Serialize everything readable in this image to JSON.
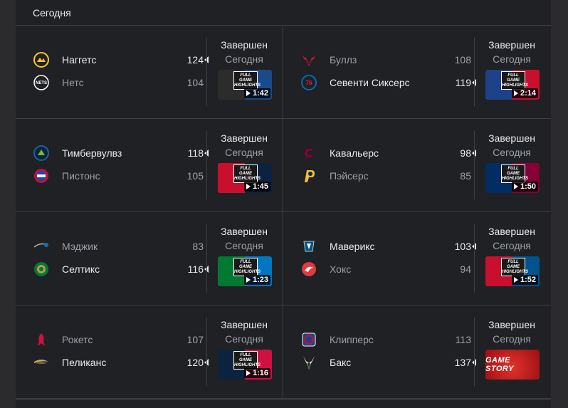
{
  "header": {
    "title": "Сегодня"
  },
  "games": [
    {
      "status": "Завершен",
      "day": "Сегодня",
      "duration": "1:42",
      "video": "highlights",
      "colors": [
        "#2c2c2c",
        "#1a4a8a"
      ],
      "home": {
        "name": "Наггетс",
        "score": "124",
        "winner": true,
        "icon": "nuggets-logo-icon",
        "color": "#fec524"
      },
      "away": {
        "name": "Нетс",
        "score": "104",
        "winner": false,
        "icon": "nets-logo-icon",
        "color": "#ffffff"
      }
    },
    {
      "status": "Завершен",
      "day": "Сегодня",
      "duration": "2:14",
      "video": "highlights",
      "colors": [
        "#1d428a",
        "#c8102e"
      ],
      "home": {
        "name": "Буллз",
        "score": "108",
        "winner": false,
        "icon": "bulls-logo-icon",
        "color": "#ce1141"
      },
      "away": {
        "name": "Севенти Сиксерс",
        "score": "119",
        "winner": true,
        "icon": "sixers-logo-icon",
        "color": "#006bb6"
      }
    },
    {
      "status": "Завершен",
      "day": "Сегодня",
      "duration": "1:45",
      "video": "highlights",
      "colors": [
        "#c8102e",
        "#0c2340"
      ],
      "home": {
        "name": "Тимбервулвз",
        "score": "118",
        "winner": true,
        "icon": "timberwolves-logo-icon",
        "color": "#236192"
      },
      "away": {
        "name": "Пистонс",
        "score": "105",
        "winner": false,
        "icon": "pistons-logo-icon",
        "color": "#c8102e"
      }
    },
    {
      "status": "Завершен",
      "day": "Сегодня",
      "duration": "1:50",
      "video": "highlights",
      "colors": [
        "#002d62",
        "#860038"
      ],
      "home": {
        "name": "Кавальерс",
        "score": "98",
        "winner": true,
        "icon": "cavaliers-logo-icon",
        "color": "#860038"
      },
      "away": {
        "name": "Пэйсерс",
        "score": "85",
        "winner": false,
        "icon": "pacers-logo-icon",
        "color": "#fdbb30"
      }
    },
    {
      "status": "Завершен",
      "day": "Сегодня",
      "duration": "1:23",
      "video": "highlights",
      "colors": [
        "#007a33",
        "#0077c0"
      ],
      "home": {
        "name": "Мэджик",
        "score": "83",
        "winner": false,
        "icon": "magic-logo-icon",
        "color": "#0077c0"
      },
      "away": {
        "name": "Селтикс",
        "score": "116",
        "winner": true,
        "icon": "celtics-logo-icon",
        "color": "#007a33"
      }
    },
    {
      "status": "Завершен",
      "day": "Сегодня",
      "duration": "1:52",
      "video": "highlights",
      "colors": [
        "#c8102e",
        "#00538c"
      ],
      "home": {
        "name": "Маверикс",
        "score": "103",
        "winner": true,
        "icon": "mavericks-logo-icon",
        "color": "#00538c"
      },
      "away": {
        "name": "Хокс",
        "score": "94",
        "winner": false,
        "icon": "hawks-logo-icon",
        "color": "#e03a3e"
      }
    },
    {
      "status": "Завершен",
      "day": "Сегодня",
      "duration": "1:16",
      "video": "highlights",
      "colors": [
        "#0c2340",
        "#ce1141"
      ],
      "home": {
        "name": "Рокетс",
        "score": "107",
        "winner": false,
        "icon": "rockets-logo-icon",
        "color": "#ce1141"
      },
      "away": {
        "name": "Пеликанс",
        "score": "120",
        "winner": true,
        "icon": "pelicans-logo-icon",
        "color": "#c8a86b"
      }
    },
    {
      "status": "Завершен",
      "day": "Сегодня",
      "duration": "",
      "video": "game-story",
      "story_label": "GAME STORY",
      "colors": [
        "#e0322e",
        "#9a0f12"
      ],
      "home": {
        "name": "Клипперс",
        "score": "113",
        "winner": false,
        "icon": "clippers-logo-icon",
        "color": "#c8102e"
      },
      "away": {
        "name": "Бакс",
        "score": "137",
        "winner": true,
        "icon": "bucks-logo-icon",
        "color": "#00471b"
      }
    }
  ],
  "video_badge_text": "FULL GAME HIGHLIGHTS"
}
